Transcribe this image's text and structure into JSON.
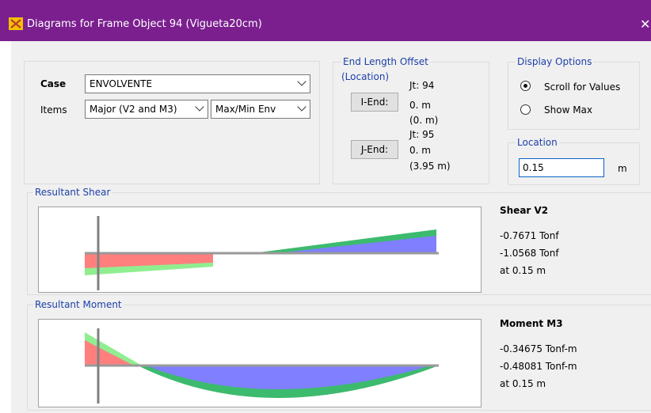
{
  "window": {
    "title": "Diagrams for Frame Object 94  (Vigueta20cm)",
    "close_glyph": "✕",
    "title_bar_color": "#7b1f8f",
    "app_icon": "sap2000-icon"
  },
  "case": {
    "label": "Case",
    "value": "ENVOLVENTE"
  },
  "items": {
    "label": "Items",
    "component": "Major (V2 and M3)",
    "envelope": "Max/Min Env"
  },
  "end_length_offset": {
    "title": "End Length Offset",
    "subtitle": "(Location)",
    "i_end": {
      "joint": "Jt: 94",
      "button": "I-End:",
      "offset": "0. m",
      "location": "(0. m)"
    },
    "j_end": {
      "joint": "Jt: 95",
      "button": "J-End:",
      "offset": "0. m",
      "location": "(3.95 m)"
    }
  },
  "display_options": {
    "title": "Display Options",
    "options": [
      "Scroll for Values",
      "Show Max"
    ],
    "selected": "Scroll for Values"
  },
  "location": {
    "title": "Location",
    "value": "0.15",
    "unit": "m"
  },
  "shear": {
    "section_title": "Resultant Shear",
    "heading": "Shear V2",
    "value_1": "-0.7671 Tonf",
    "value_2": "-1.0568 Tonf",
    "at": "at 0.15 m"
  },
  "moment": {
    "section_title": "Resultant Moment",
    "heading": "Moment M3",
    "value_1": "-0.34675 Tonf-m",
    "value_2": "-0.48081 Tonf-m",
    "at": "at 0.15 m"
  },
  "colors": {
    "positive_fill": "#7f7fff",
    "negative_fill": "#ff7f7f",
    "envelope_fill": "#3cba6e",
    "envelope_light": "#90ee90",
    "group_title": "#1d3fa8"
  }
}
